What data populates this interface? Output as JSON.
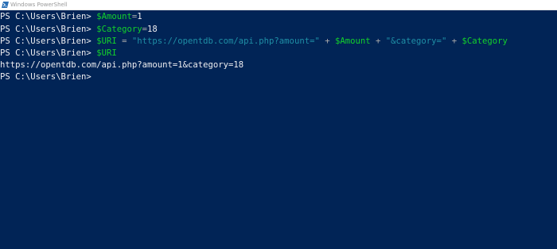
{
  "window": {
    "title": "Windows PowerShell",
    "icon": "powershell-icon"
  },
  "colors": {
    "console_background": "#012456",
    "default_text": "#eeedf0",
    "variable": "#13d12b",
    "operator": "#a9a9a9",
    "string": "#1f8fa6"
  },
  "console": {
    "lines": [
      {
        "prompt": "PS C:\\Users\\Brien> ",
        "tokens": [
          "$Amount",
          "=",
          "1"
        ]
      },
      {
        "prompt": "PS C:\\Users\\Brien> ",
        "tokens": [
          "$Category",
          "=",
          "18"
        ]
      },
      {
        "prompt": "PS C:\\Users\\Brien> ",
        "tokens": [
          "$URI",
          " = ",
          "\"https://opentdb.com/api.php?amount=\"",
          " + ",
          "$Amount",
          " + ",
          "\"&category=\"",
          " + ",
          "$Category"
        ]
      },
      {
        "prompt": "PS C:\\Users\\Brien> ",
        "tokens": [
          "$URI"
        ]
      },
      {
        "output": "https://opentdb.com/api.php?amount=1&category=18"
      },
      {
        "prompt": "PS C:\\Users\\Brien> "
      }
    ]
  }
}
